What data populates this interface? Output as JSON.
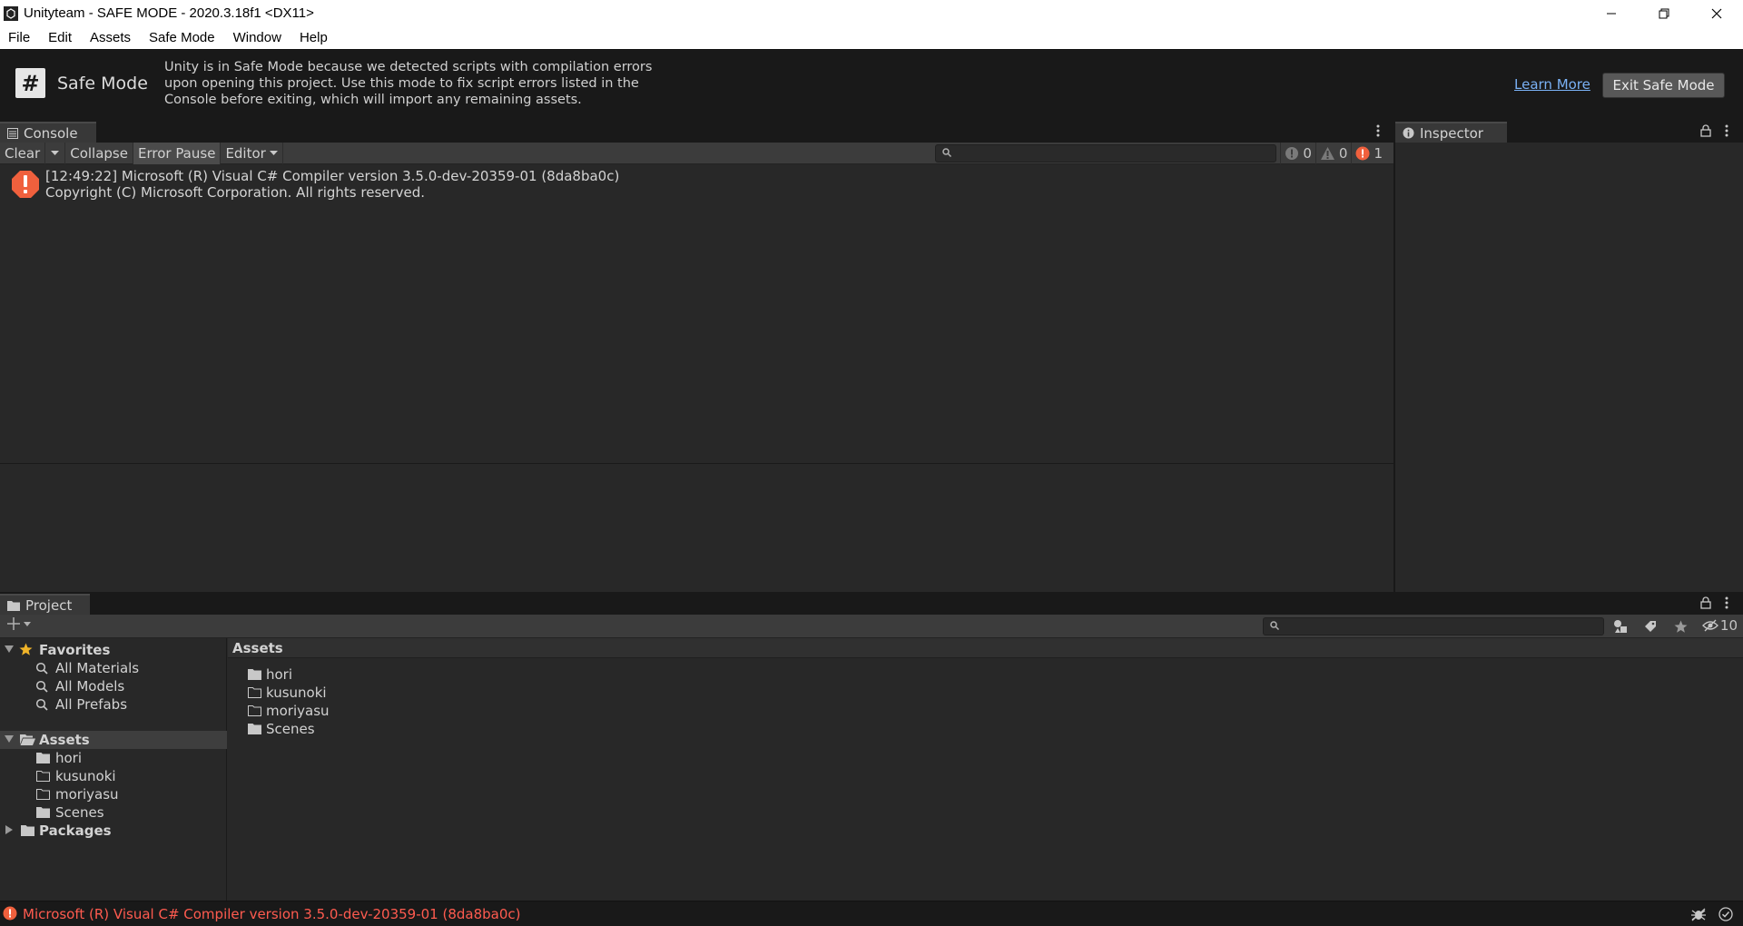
{
  "window": {
    "title": "Unityteam - SAFE MODE - 2020.3.18f1 <DX11>"
  },
  "menu": [
    "File",
    "Edit",
    "Assets",
    "Safe Mode",
    "Window",
    "Help"
  ],
  "safe_mode": {
    "badge": "#",
    "title": "Safe Mode",
    "message": "Unity is in Safe Mode because we detected scripts with compilation errors upon opening this project. Use this mode to fix script errors listed in the Console before exiting, which will import any remaining assets.",
    "learn_more": "Learn More",
    "exit_button": "Exit Safe Mode"
  },
  "console": {
    "tab_label": "Console",
    "toolbar": {
      "clear": "Clear",
      "collapse": "Collapse",
      "error_pause": "Error Pause",
      "editor": "Editor"
    },
    "search_placeholder": "",
    "counts": {
      "info": "0",
      "warnings": "0",
      "errors": "1"
    },
    "logs": [
      {
        "type": "error",
        "line1": "[12:49:22] Microsoft (R) Visual C# Compiler version 3.5.0-dev-20359-01 (8da8ba0c)",
        "line2": "Copyright (C) Microsoft Corporation. All rights reserved."
      }
    ]
  },
  "inspector": {
    "tab_label": "Inspector"
  },
  "project": {
    "tab_label": "Project",
    "hidden_count": "10",
    "favorites": {
      "label": "Favorites",
      "items": [
        "All Materials",
        "All Models",
        "All Prefabs"
      ]
    },
    "assets_tree": {
      "label": "Assets",
      "children": [
        "hori",
        "kusunoki",
        "moriyasu",
        "Scenes"
      ]
    },
    "packages_label": "Packages",
    "breadcrumb": "Assets",
    "grid_items": [
      {
        "name": "hori",
        "filled": true
      },
      {
        "name": "kusunoki",
        "filled": false
      },
      {
        "name": "moriyasu",
        "filled": false
      },
      {
        "name": "Scenes",
        "filled": true
      }
    ]
  },
  "status": {
    "message": "Microsoft (R) Visual C# Compiler version 3.5.0-dev-20359-01 (8da8ba0c)"
  },
  "colors": {
    "error": "#f0603d",
    "link": "#7ab1f5",
    "star": "#f0b429",
    "status_error_text": "#ff5b4f"
  }
}
